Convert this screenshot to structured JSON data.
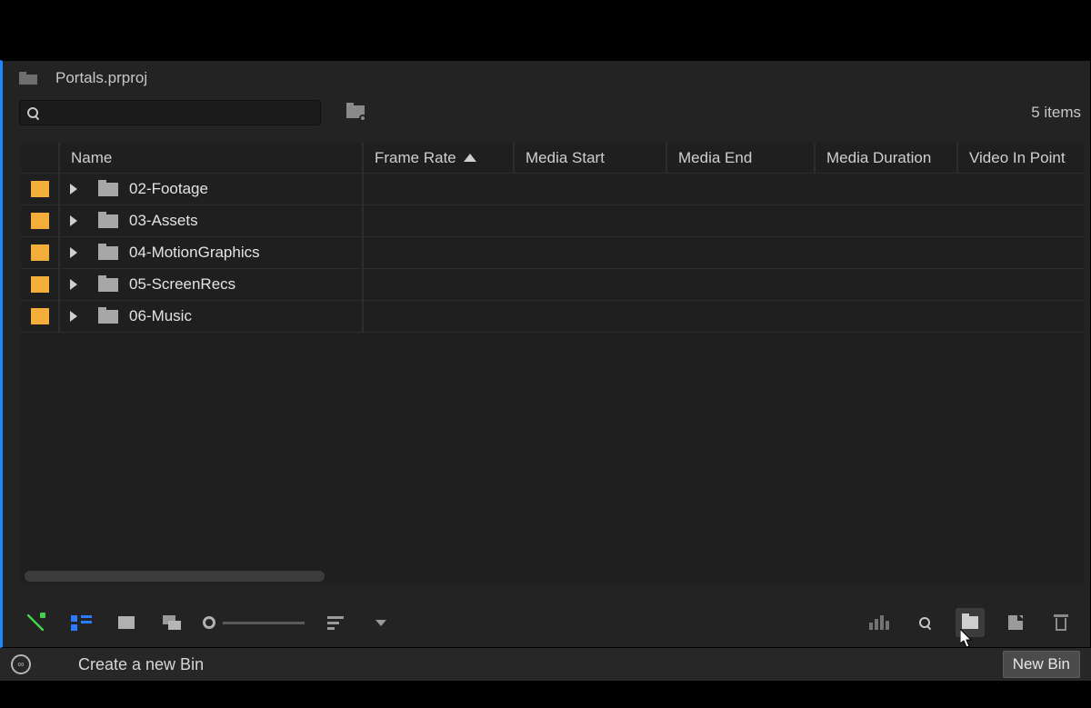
{
  "project": {
    "name": "Portals.prproj"
  },
  "toolbar": {
    "filter_value": "",
    "filter_placeholder": "",
    "items_count": "5 items"
  },
  "columns": {
    "name": "Name",
    "frame_rate": "Frame Rate",
    "media_start": "Media Start",
    "media_end": "Media End",
    "media_duration": "Media Duration",
    "video_in_point": "Video In Point"
  },
  "bins": [
    {
      "name": "02-Footage"
    },
    {
      "name": "03-Assets"
    },
    {
      "name": "04-MotionGraphics"
    },
    {
      "name": "05-ScreenRecs"
    },
    {
      "name": "06-Music"
    }
  ],
  "tipbar": {
    "hint": "Create a new Bin",
    "tooltip": "New Bin"
  }
}
